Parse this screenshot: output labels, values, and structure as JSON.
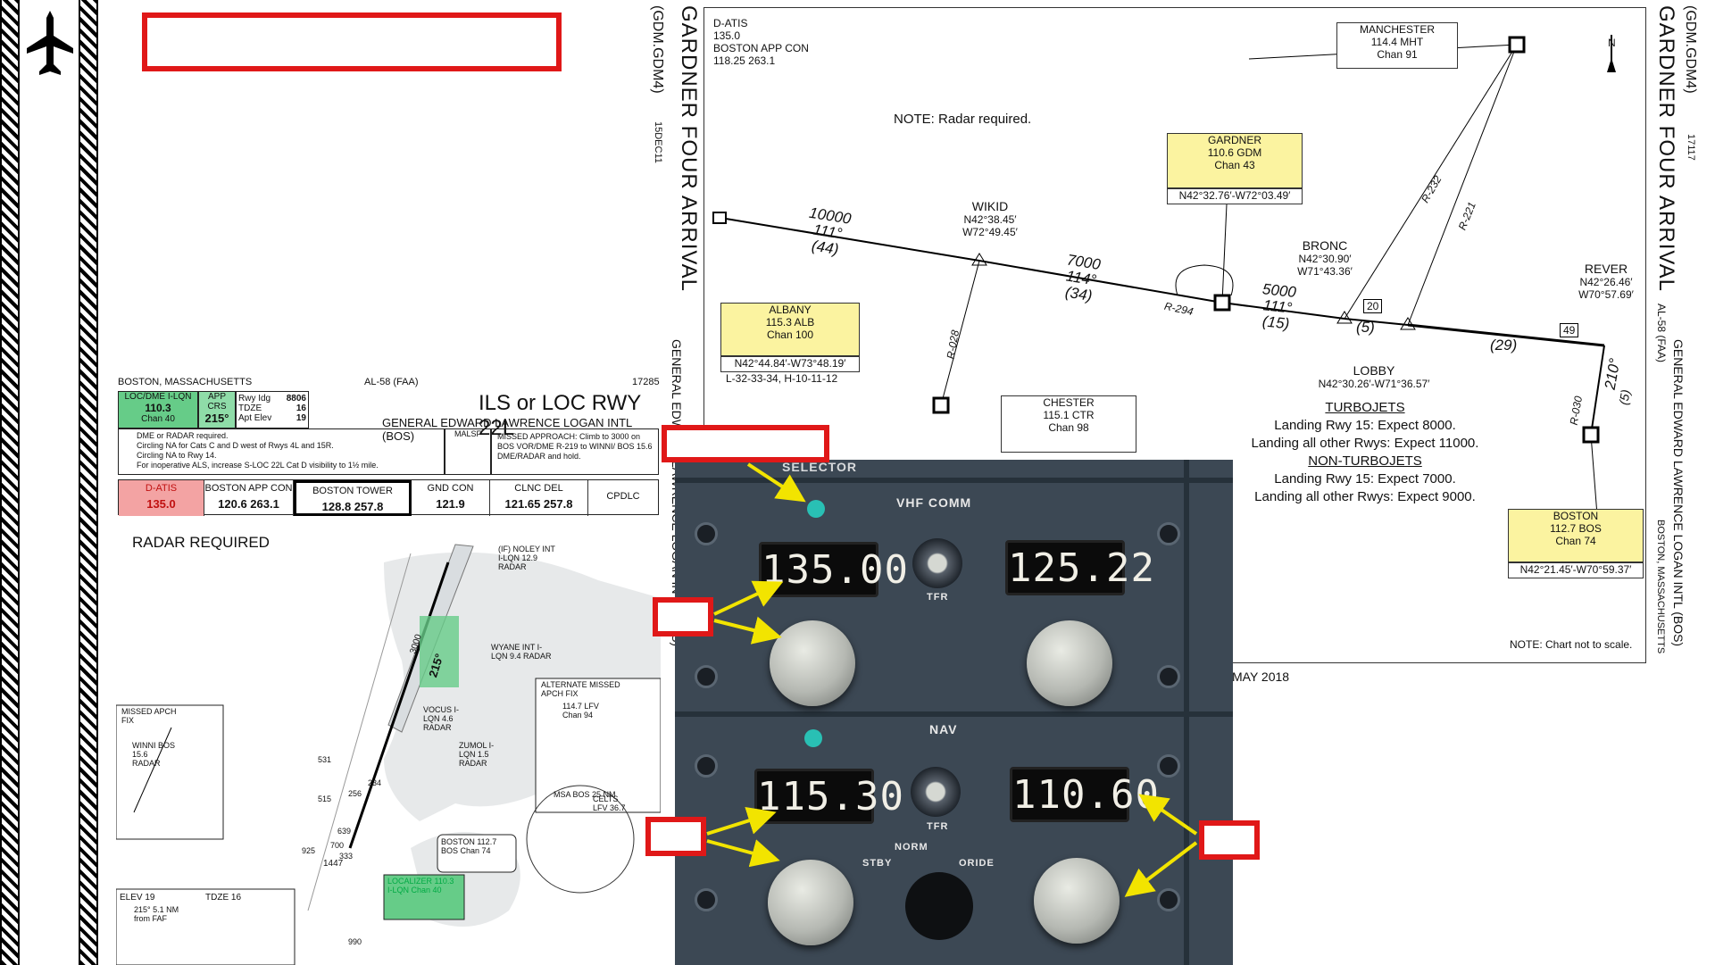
{
  "left_bar": {
    "icon": "airplane-icon"
  },
  "ils_chart": {
    "location": "BOSTON, MASSACHUSETTS",
    "chart_ref": "AL-58 (FAA)",
    "amdt": "17285",
    "title": "ILS or LOC RWY 22L",
    "airport": "GENERAL EDWARD LAWRENCE LOGAN INTL (BOS)",
    "loc_label": "LOC/DME I-LQN",
    "loc_freq": "110.3",
    "loc_chan": "Chan 40",
    "app_crs_label": "APP CRS",
    "app_crs": "215°",
    "rwy_ldg_label": "Rwy Idg",
    "rwy_ldg": "8806",
    "tdze_label": "TDZE",
    "tdze": "16",
    "apt_elev_label": "Apt Elev",
    "apt_elev": "19",
    "note1": "DME or RADAR required.",
    "note2": "Circling NA for Cats C and D west of Rwys 4L and 15R.",
    "note3": "Circling NA to Rwy 14.",
    "note4": "For inoperative ALS, increase S-LOC 22L Cat D visibility to 1½ mile.",
    "malsf": "MALSF",
    "missed_approach": "MISSED APPROACH: Climb to 3000 on BOS VOR/DME R-219 to WINNI/ BOS 15.6 DME/RADAR and hold.",
    "freqs": [
      {
        "label": "D-ATIS",
        "value": "135.0"
      },
      {
        "label": "BOSTON APP CON",
        "value": "120.6  263.1"
      },
      {
        "label": "BOSTON TOWER",
        "value": "128.8  257.8"
      },
      {
        "label": "GND CON",
        "value": "121.9"
      },
      {
        "label": "CLNC DEL",
        "value": "121.65  257.8"
      },
      {
        "label": "CPDLC",
        "value": ""
      }
    ],
    "radar_required": "RADAR REQUIRED",
    "missed_apch_fix": "MISSED APCH FIX",
    "winni": "WINNI BOS 15.6 RADAR",
    "alt_missed": "ALTERNATE MISSED APCH FIX",
    "alt_missed_sub": "114.7 LFV Chan 94",
    "celts": "CELTS LFV 36.7",
    "noley": "(IF) NOLEY INT I-LQN 12.9 RADAR",
    "wyane": "WYANE INT I-LQN 9.4 RADAR",
    "vocus": "VOCUS I-LQN 4.6 RADAR",
    "zumol": "ZUMOL I-LQN 1.5 RADAR",
    "boston_vor": "BOSTON 112.7 BOS Chan 74",
    "localizer": "LOCALIZER 110.3 I-LQN Chan 40",
    "msa": "MSA BOS 25 NM",
    "elev": "ELEV  19",
    "tdze2": "TDZE  16",
    "faf_note": "215° 5.1 NM from FAF",
    "ob1447": "1447",
    "ob531": "531",
    "ob515": "515",
    "ob256": "256",
    "ob234": "234",
    "ob639": "639",
    "ob925": "925",
    "ob700": "700",
    "ob333": "333",
    "ob990": "990",
    "crs": "215°",
    "alt": "3000"
  },
  "star_chart": {
    "datis_label": "D-ATIS",
    "datis_freq": "135.0",
    "app_label": "BOSTON APP CON",
    "app_freq": "118.25  263.1",
    "note": "NOTE:  Radar required.",
    "title": "GARDNER FOUR ARRIVAL",
    "code": "(GDM.GDM4)",
    "date": "15DEC11",
    "code_right": "(GDM.GDM4)",
    "date_right": "17117",
    "manchester": {
      "name": "MANCHESTER",
      "freq": "114.4  MHT",
      "chan": "Chan  91"
    },
    "gardner": {
      "name": "GARDNER",
      "freq": "110.6  GDM",
      "chan": "Chan  43",
      "coord": "N42°32.76′-W72°03.49′"
    },
    "albany": {
      "name": "ALBANY",
      "freq": "115.3  ALB",
      "chan": "Chan  100",
      "coord": "N42°44.84′-W73°48.19′",
      "ref": "L-32-33-34, H-10-11-12"
    },
    "chester": {
      "name": "CHESTER",
      "freq": "115.1  CTR",
      "chan": "Chan  98"
    },
    "boston": {
      "name": "BOSTON",
      "freq": "112.7  BOS",
      "chan": "Chan  74",
      "coord": "N42°21.45′-W70°59.37′"
    },
    "wikid": {
      "name": "WIKID",
      "coord1": "N42°38.45′",
      "coord2": "W72°49.45′"
    },
    "bronc": {
      "name": "BRONC",
      "coord1": "N42°30.90′",
      "coord2": "W71°43.36′"
    },
    "lobby": {
      "name": "LOBBY",
      "coord": "N42°30.26′-W71°36.57′"
    },
    "rever": {
      "name": "REVER",
      "coord1": "N42°26.46′",
      "coord2": "W70°57.69′"
    },
    "seg1": {
      "alt": "10000",
      "crs": "111°",
      "dist": "(44)"
    },
    "seg2": {
      "alt": "7000",
      "crs": "114°",
      "dist": "(34)"
    },
    "seg3": {
      "alt": "5000",
      "crs": "111°",
      "dist": "(15)"
    },
    "seg4": {
      "dist": "(5)"
    },
    "seg5": {
      "dist": "(29)"
    },
    "seg6": {
      "crs": "210°",
      "dist": "(5)"
    },
    "r294": "R-294",
    "r028": "R-028",
    "r232": "R-232",
    "r221": "R-221",
    "r030": "R-030",
    "n20": "20",
    "n49": "49",
    "north": "N",
    "turbojets": "TURBOJETS",
    "tj1": "Landing Rwy 15: Expect 8000.",
    "tj2": "Landing all other Rwys:  Expect 11000.",
    "nonturbojets": "NON-TURBOJETS",
    "ntj1": "Landing Rwy 15:  Expect 7000.",
    "ntj2": "Landing all other Rwys:  Expect 9000.",
    "not_to_scale": "NOTE:  Chart not to scale.",
    "side_ref": "AL-58 (FAA)",
    "side_airport": "GENERAL EDWARD LAWRENCE LOGAN INTL (BOS)",
    "side_city": "BOSTON, MASSACHUSETTS",
    "date_bottom": "MAY 2018"
  },
  "panel": {
    "selector": "SELECTOR",
    "vhf_comm": "VHF  COMM",
    "nav": "NAV",
    "comm_active": "135.00",
    "comm_standby": "125.22",
    "nav_active": "115.30",
    "nav_standby": "110.60",
    "tfr": "TFR",
    "tfr2": "TFR",
    "stby": "STBY",
    "norm": "NORM",
    "oride": "ORIDE"
  },
  "colors": {
    "callout_red": "#e01818",
    "arrow_yellow": "#f2e400",
    "panel": "#3c4854",
    "led": "#29c0b4"
  }
}
